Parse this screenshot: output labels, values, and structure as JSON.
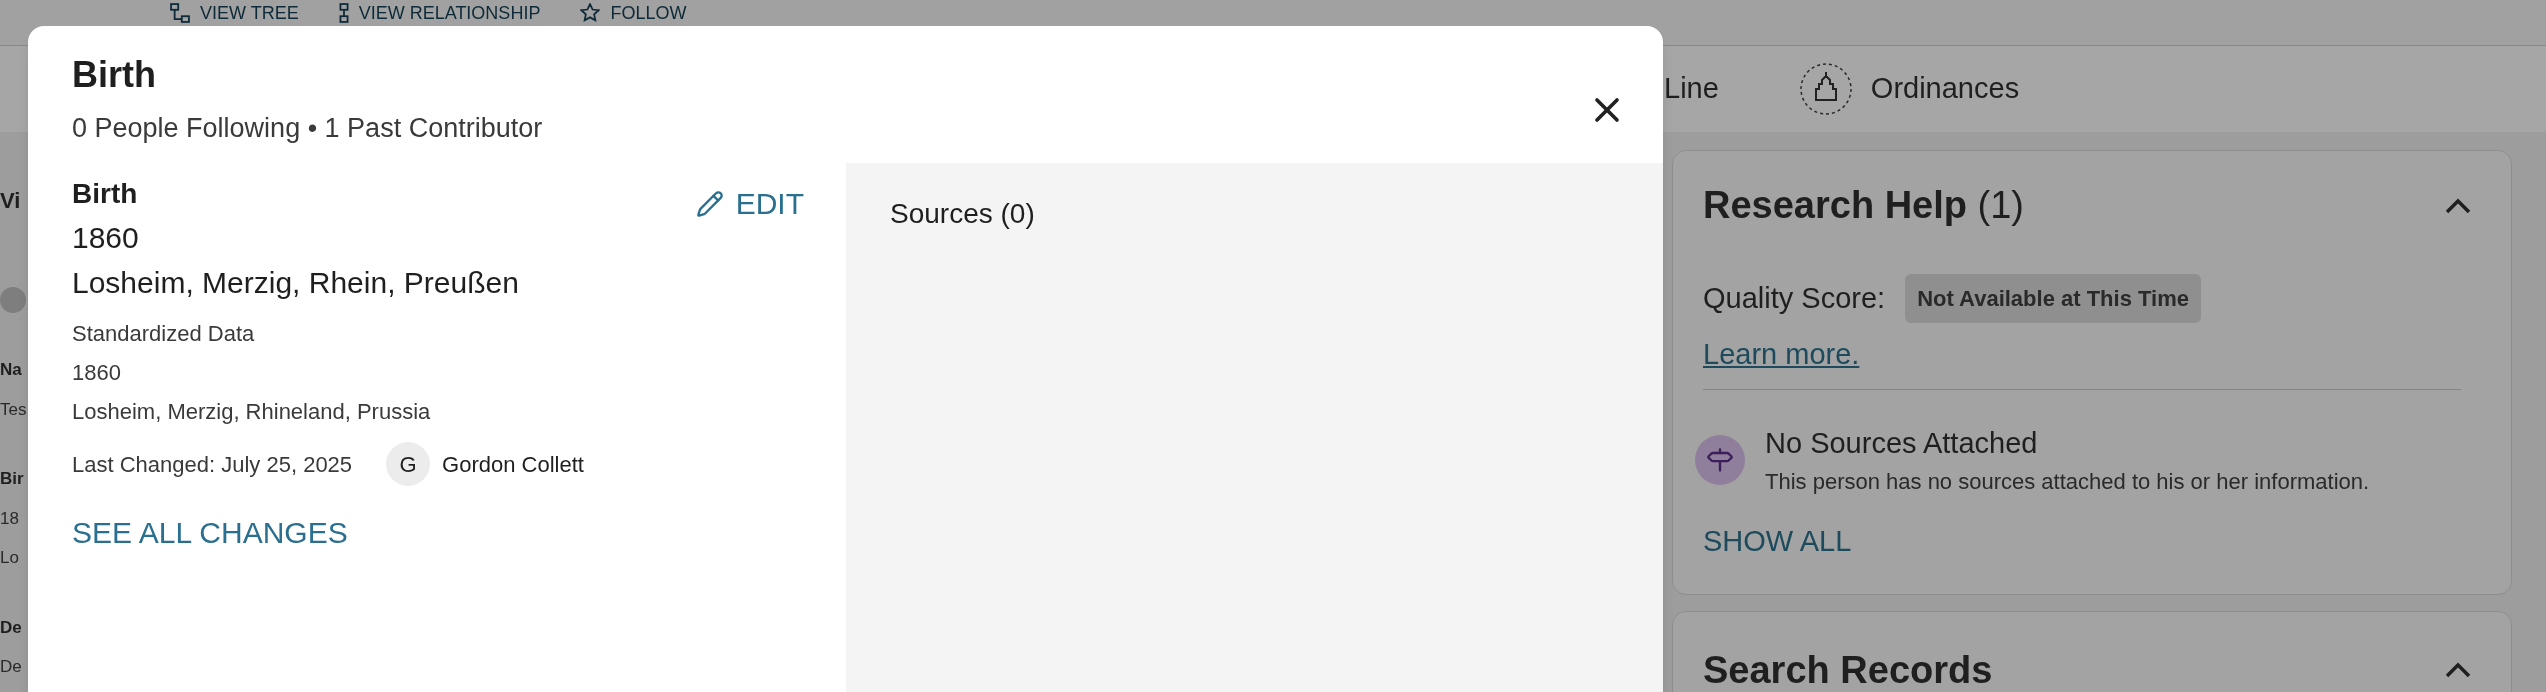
{
  "background": {
    "top_actions": [
      {
        "kind": "tree",
        "label": "VIEW TREE"
      },
      {
        "kind": "relationship",
        "label": "VIEW RELATIONSHIP"
      },
      {
        "kind": "follow",
        "label": "FOLLOW"
      }
    ],
    "tabs": [
      {
        "kind": "plain",
        "label": "Line"
      },
      {
        "kind": "temple",
        "label": "Ordinances"
      }
    ],
    "left_fragments": [
      {
        "kind": "heading",
        "text": "Vi"
      },
      {
        "kind": "toggle",
        "on": false
      },
      {
        "kind": "label",
        "text": "Na"
      },
      {
        "kind": "value",
        "text": "Tes"
      },
      {
        "kind": "label",
        "text": "Bir"
      },
      {
        "kind": "value",
        "text": "18"
      },
      {
        "kind": "value",
        "text": "Lo"
      },
      {
        "kind": "label",
        "text": "De"
      },
      {
        "kind": "value",
        "text": "De"
      }
    ],
    "research_help": {
      "title": "Research Help",
      "count": "(1)",
      "expanded": true,
      "quality_label": "Quality Score:",
      "quality_value": "Not Available at This Time",
      "learn_more": "Learn more.",
      "notice_title": "No Sources Attached",
      "notice_text": "This person has no sources attached to his or her information.",
      "show_all": "SHOW ALL"
    },
    "search_records": {
      "title": "Search Records",
      "expanded": true
    }
  },
  "modal": {
    "title": "Birth",
    "subtitle": "0 People Following • 1 Past Contributor",
    "event": {
      "label": "Birth",
      "date": "1860",
      "place": "Losheim, Merzig, Rhein, Preußen",
      "standardized_heading": "Standardized Data",
      "standardized_date": "1860",
      "standardized_place": "Losheim, Merzig, Rhineland, Prussia",
      "last_changed": "Last Changed: July 25, 2025",
      "contributor_initial": "G",
      "contributor_name": "Gordon Collett"
    },
    "edit_button": "EDIT",
    "see_all_changes": "SEE ALL CHANGES",
    "sources_heading": "Sources (0)"
  }
}
